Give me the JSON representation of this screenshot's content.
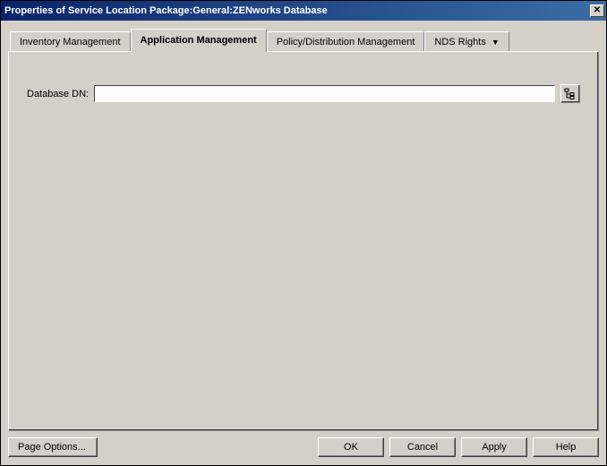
{
  "window": {
    "title": "Properties of Service Location Package:General:ZENworks Database"
  },
  "tabs": {
    "inventory": "Inventory Management",
    "application": "Application Management",
    "policy": "Policy/Distribution Management",
    "nds": "NDS Rights"
  },
  "form": {
    "database_dn_label": "Database DN:",
    "database_dn_value": ""
  },
  "buttons": {
    "page_options": "Page Options...",
    "ok": "OK",
    "cancel": "Cancel",
    "apply": "Apply",
    "help": "Help"
  }
}
